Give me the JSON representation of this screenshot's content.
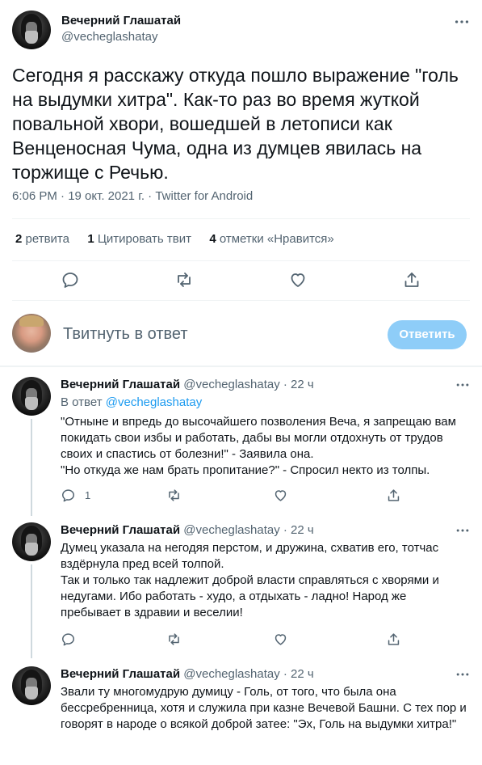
{
  "main_tweet": {
    "author_name": "Вечерний Глашатай",
    "author_handle": "@vecheglashatay",
    "text_lines": [
      "Сегодня я расскажу откуда пошло выражение \"голь",
      "на выдумки хитра\". Как-то раз во время жуткой",
      "повальной хвори, вошедшей в летописи как",
      "Венценосная Чума, одна из думцев явилась на",
      "торжище с Речью."
    ],
    "timestamp": "6:06 PM · 19 окт. 2021 г. · Twitter for Android",
    "stats": {
      "retweets_count": "2",
      "retweets_label": "ретвита",
      "quotes_count": "1",
      "quotes_label": "Цитировать твит",
      "likes_count": "4",
      "likes_label": "отметки «Нравится»"
    }
  },
  "compose": {
    "placeholder": "Твитнуть в ответ",
    "button_label": "Ответить"
  },
  "replies": [
    {
      "author_name": "Вечерний Глашатай",
      "author_handle": "@vecheglashatay",
      "time": "· 22 ч",
      "reply_to_prefix": "В ответ",
      "reply_to_handle": "@vecheglashatay",
      "text_lines": [
        "\"Отныне и впредь до высочайшего позволения Веча, я запрещаю вам",
        "покидать свои избы и работать, дабы вы могли отдохнуть от трудов",
        "своих и спастись от болезни!\" - Заявила она.",
        "\"Но откуда же нам брать пропитание?\" - Спросил некто из толпы."
      ],
      "reply_count": "1"
    },
    {
      "author_name": "Вечерний Глашатай",
      "author_handle": "@vecheglashatay",
      "time": "· 22 ч",
      "text_lines": [
        "Думец указала на негодяя перстом, и дружина, схватив его, тотчас",
        "вздёрнула пред всей толпой.",
        "Так и только так надлежит доброй власти справляться с хворями и",
        "недугами. Ибо работать - худо, а отдыхать - ладно! Народ же",
        "пребывает в здравии и веселии!"
      ]
    },
    {
      "author_name": "Вечерний Глашатай",
      "author_handle": "@vecheglashatay",
      "time": "· 22 ч",
      "text_lines": [
        "Звали ту многомудрую думицу - Голь, от того, что была она",
        "бессребренница, хотя и служила при казне Вечевой Башни. С тех пор и",
        "говорят в народе о всякой доброй затее: \"Эх, Голь на выдумки хитра!\""
      ]
    }
  ],
  "icons": {
    "more": "more-icon",
    "reply": "reply-icon",
    "retweet": "retweet-icon",
    "like": "like-icon",
    "share": "share-icon"
  },
  "colors": {
    "accent": "#1d9bf0",
    "button_disabled": "#8ecdf8",
    "secondary_text": "#536471",
    "divider": "#eff3f4"
  }
}
